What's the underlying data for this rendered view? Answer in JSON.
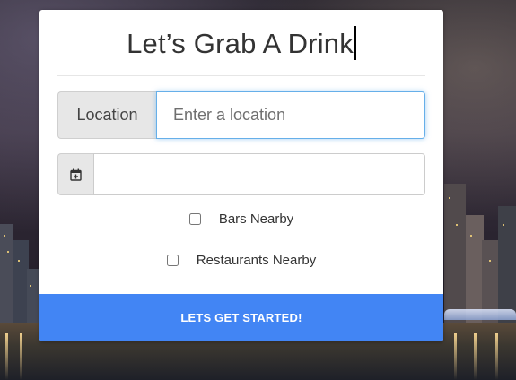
{
  "form": {
    "title": "Let’s Grab A Drink",
    "location_label": "Location",
    "location_placeholder": "Enter a location",
    "location_value": "",
    "date_value": "",
    "date_icon": "calendar-plus-icon",
    "options": [
      {
        "label": "Bars Nearby",
        "checked": false
      },
      {
        "label": "Restaurants Nearby",
        "checked": false
      }
    ],
    "submit_label": "LETS GET STARTED!"
  },
  "colors": {
    "primary_button": "#4285f4",
    "input_focus_border": "#66afe9",
    "addon_bg": "#e7e7e7"
  }
}
